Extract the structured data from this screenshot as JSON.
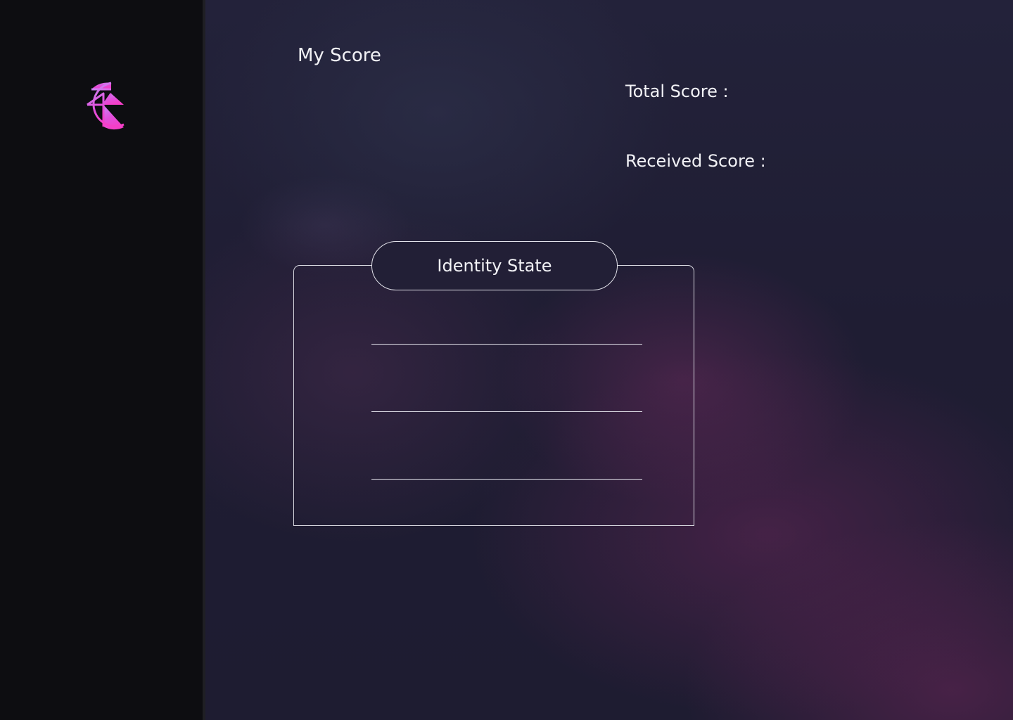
{
  "sidebar": {
    "logo_icon": "brand-logo-icon",
    "accent_colors": [
      "#c07ef2",
      "#ee3fcf"
    ]
  },
  "main": {
    "title": "My Score",
    "total_score_label": "Total Score :",
    "received_score_label": "Received Score :",
    "identity_card": {
      "heading": "Identity State",
      "entries": [
        "",
        "",
        ""
      ]
    }
  },
  "colors": {
    "sidebar_bg": "#0d0d11",
    "main_bg": "#1e1c31",
    "text": "#f2f2f6",
    "border": "#d8d8e0"
  }
}
